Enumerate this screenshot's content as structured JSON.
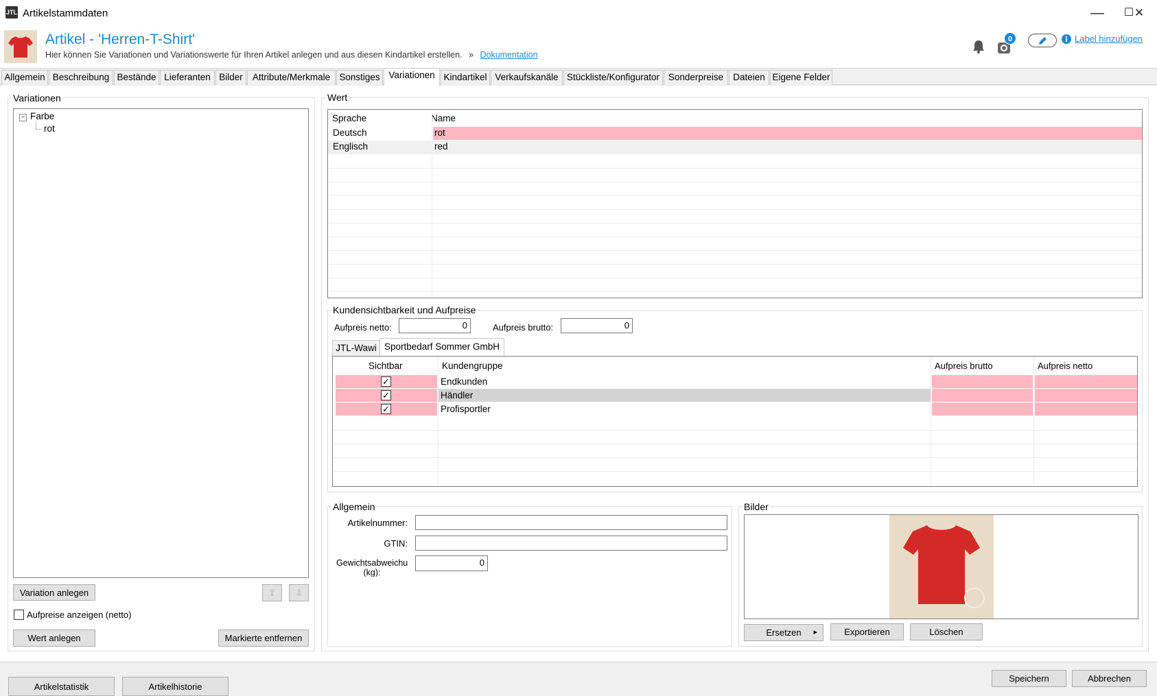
{
  "window": {
    "logo": "JTL",
    "title": "Artikelstammdaten",
    "minimize": "—",
    "maximize": "☐",
    "close": "✕"
  },
  "header": {
    "title": "Artikel - 'Herren-T-Shirt'",
    "subtitle": "Hier können Sie Variationen und Variationswerte für Ihren Artikel anlegen und aus diesen Kindartikel erstellen.",
    "arrow": "»",
    "doc_link": "Dokumentation",
    "sync_badge": "0",
    "label_link": "Label hinzufügen",
    "bell_icon": "bell-icon",
    "sync_icon": "sync-icon",
    "edit_icon": "pencil-icon",
    "info_icon": "info-icon"
  },
  "tabs": [
    "Allgemein",
    "Beschreibung",
    "Bestände",
    "Lieferanten",
    "Bilder",
    "Attribute/Merkmale",
    "Sonstiges",
    "Variationen",
    "Kindartikel",
    "Verkaufskanäle",
    "Stückliste/Konfigurator",
    "Sonderpreise",
    "Dateien",
    "Eigene Felder"
  ],
  "variationen": {
    "label": "Variationen",
    "tree_root": "Farbe",
    "tree_child": "rot",
    "collapse_glyph": "−",
    "btn_add_variation": "Variation anlegen",
    "up_arrow": "⇧",
    "down_arrow": "⇩",
    "checkbox_label": "Aufpreise anzeigen (netto)",
    "btn_add_value": "Wert anlegen",
    "btn_remove": "Markierte entfernen"
  },
  "wert": {
    "label": "Wert",
    "col_sprache": "Sprache",
    "col_name": "Name",
    "rows": [
      {
        "sprache": "Deutsch",
        "name": "rot"
      },
      {
        "sprache": "Englisch",
        "name": "red"
      }
    ]
  },
  "kunden": {
    "label": "Kundensichtbarkeit und Aufpreise",
    "aufpreis_netto_label": "Aufpreis netto:",
    "aufpreis_netto_value": "0",
    "aufpreis_brutto_label": "Aufpreis brutto:",
    "aufpreis_brutto_value": "0",
    "subtabs": [
      "JTL-Wawi",
      "Sportbedarf Sommer GmbH"
    ],
    "col_sichtbar": "Sichtbar",
    "col_kundengruppe": "Kundengruppe",
    "col_aufpreis_brutto": "Aufpreis brutto",
    "col_aufpreis_netto": "Aufpreis netto",
    "check_mark": "✓",
    "rows": [
      {
        "kundengruppe": "Endkunden"
      },
      {
        "kundengruppe": "Händler"
      },
      {
        "kundengruppe": "Profisportler"
      }
    ]
  },
  "allgemein": {
    "label": "Allgemein",
    "artikelnummer_label": "Artikelnummer:",
    "gtin_label": "GTIN:",
    "gewicht_label": "Gewichtsabweichung (kg):",
    "gewicht_value": "0"
  },
  "bilder": {
    "label": "Bilder",
    "btn_replace": "Ersetzen",
    "btn_export": "Exportieren",
    "btn_delete": "Löschen",
    "dropdown_arrow": "▸"
  },
  "footer": {
    "btn_statistik": "Artikelstatistik",
    "btn_historie": "Artikelhistorie",
    "btn_save": "Speichern",
    "btn_cancel": "Abbrechen"
  },
  "colors": {
    "accent": "#1f86cc",
    "highlight": "#ffb6c1",
    "selected_row": "#d3d3d3"
  }
}
